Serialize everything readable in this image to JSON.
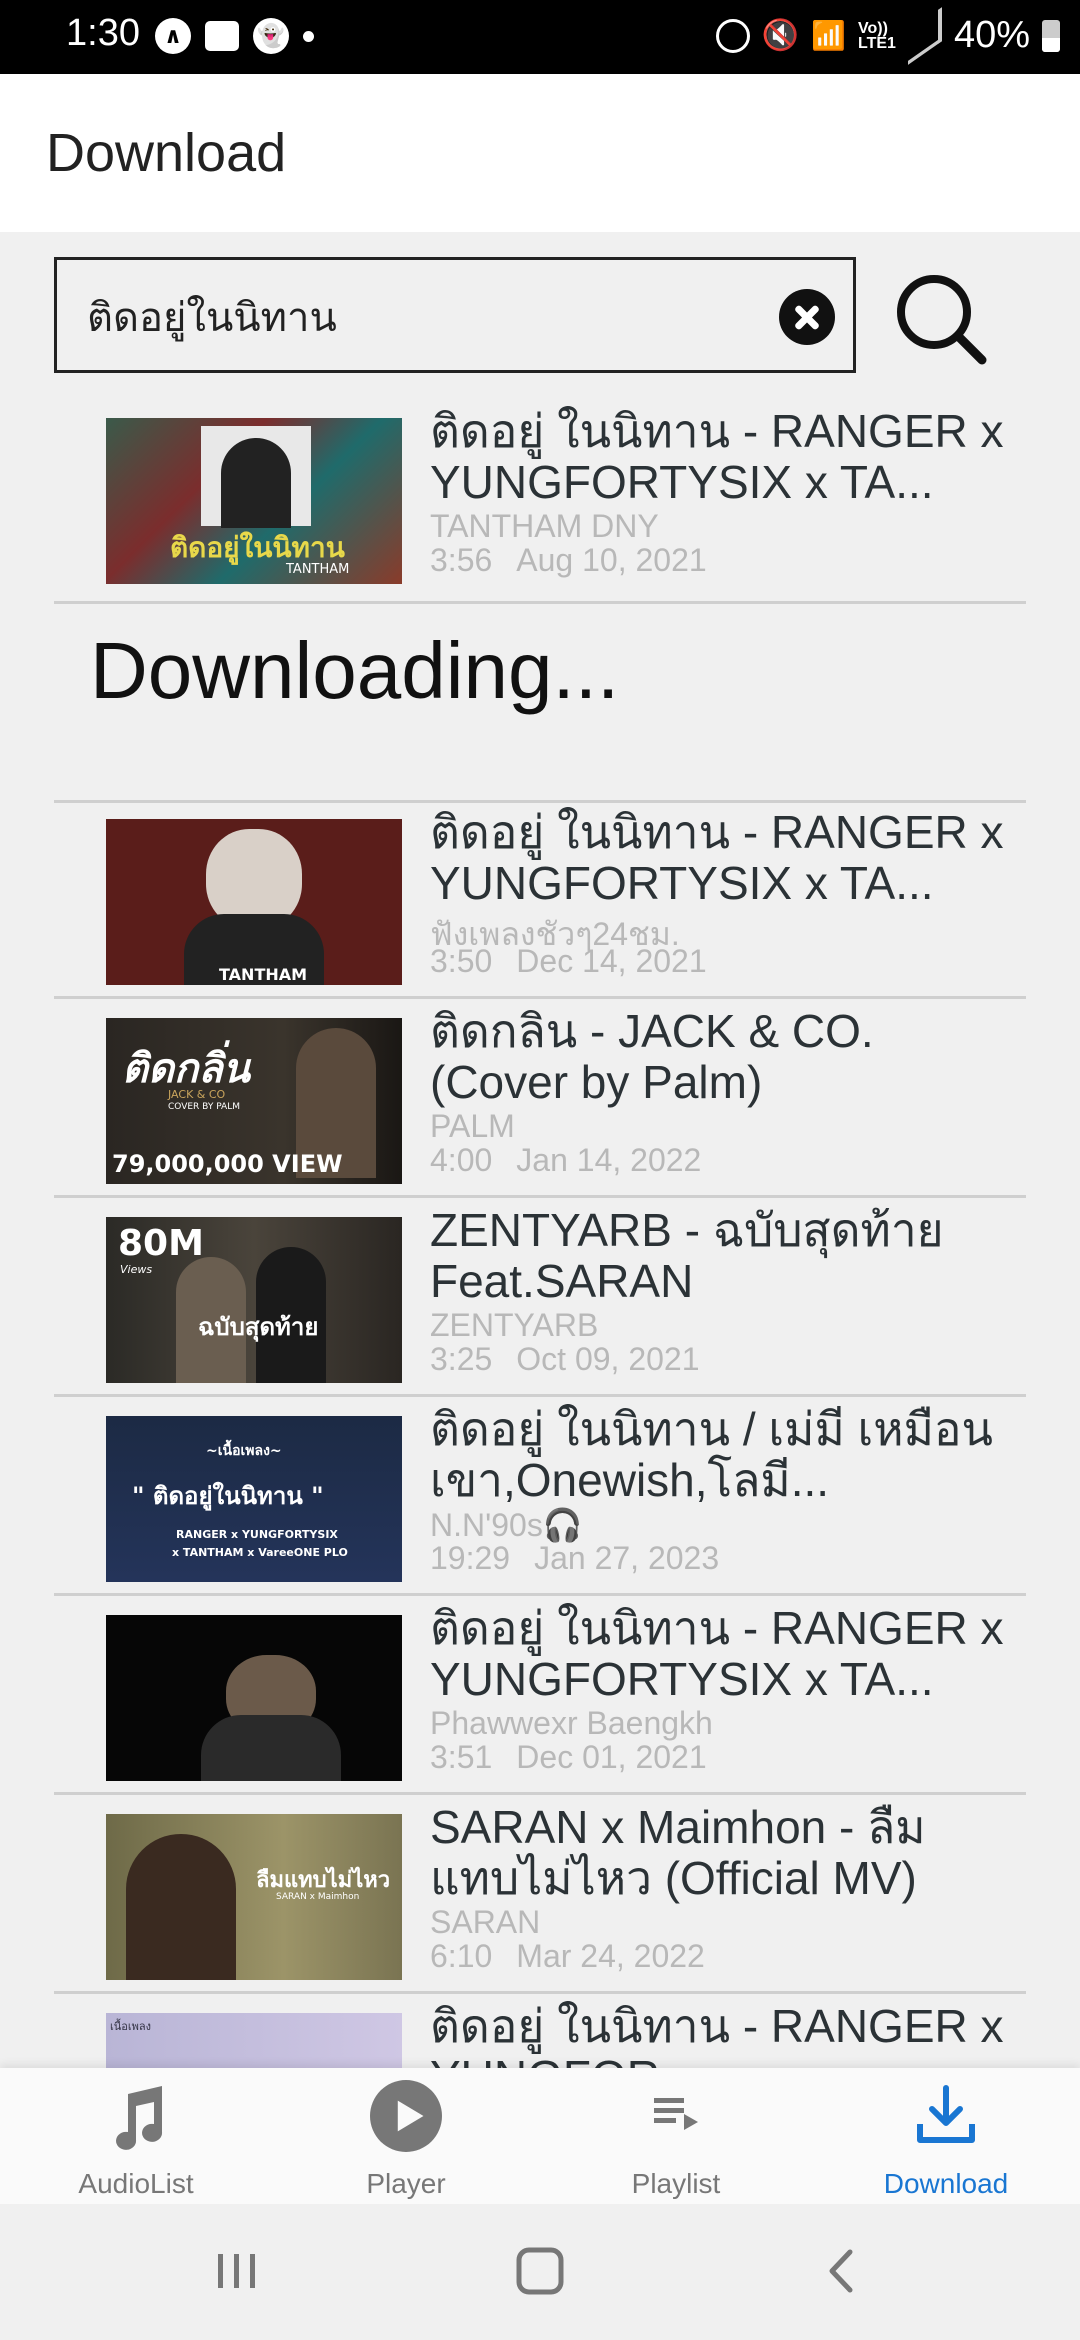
{
  "status_bar": {
    "time": "1:30",
    "net_line1": "Vo))",
    "net_line2": "LTE1",
    "battery": "40%"
  },
  "header": {
    "title": "Download"
  },
  "search": {
    "value": "ติดอยู่ในนิทาน"
  },
  "downloading_text": "Downloading...",
  "items": [
    {
      "title": "ติดอยู่ ในนิทาน - RANGER x YUNGFORTYSIX x TA...",
      "channel": "TANTHAM DNY",
      "duration": "3:56",
      "date": "Aug 10, 2021",
      "thumb_text": "ติดอยู่ในนิทาน",
      "thumb_sub": "TANTHAM"
    },
    {
      "title": "ติดอยู่ ในนิทาน - RANGER x YUNGFORTYSIX x TA...",
      "channel": "ฟังเพลงชัวๆ24ชม.",
      "duration": "3:50",
      "date": "Dec 14, 2021",
      "thumb_text": "TANTHAM"
    },
    {
      "title": "ติดกลิ่น - JACK & CO. (Cover by Palm)",
      "channel": "PALM",
      "duration": "4:00",
      "date": "Jan 14, 2022",
      "thumb_text": "ติดกลิ่น",
      "thumb_sub": "JACK & CO",
      "thumb_sub2": "COVER BY PALM",
      "thumb_views": "79,000,000 VIEW"
    },
    {
      "title": "ZENTYARB - ฉบับสุดท้าย Feat.SARAN",
      "channel": "ZENTYARB",
      "duration": "3:25",
      "date": "Oct 09, 2021",
      "thumb_text": "80M",
      "thumb_sub": "Views",
      "thumb_sub2": "ฉบับสุดท้าย"
    },
    {
      "title": "ติดอยู่ ในนิทาน / เม่มี เหมือนเขา,Onewish,โลมี...",
      "channel": "N.N'90s🎧",
      "duration": "19:29",
      "date": "Jan 27, 2023",
      "thumb_text": "~เนื้อเพลง~",
      "thumb_sub": "\" ติดอยู่ในนิทาน \"",
      "thumb_sub2": "RANGER x YUNGFORTYSIX",
      "thumb_sub3": "x TANTHAM x VareeONE PLO"
    },
    {
      "title": "ติดอยู่ ในนิทาน - RANGER x YUNGFORTYSIX x TA...",
      "channel": "Phawwexr Baengkh",
      "duration": "3:51",
      "date": "Dec 01, 2021"
    },
    {
      "title": "SARAN x Maimhon - ลืมแทบไม่ไหว (Official MV)",
      "channel": "SARAN",
      "duration": "6:10",
      "date": "Mar 24, 2022",
      "thumb_text": "ลืมแทบไม่ไหว",
      "thumb_sub": "SARAN x Maimhon"
    },
    {
      "title": "ติดอยู่ ในนิทาน - RANGER x YUNGFOR...",
      "channel": "",
      "duration": "",
      "date": "",
      "thumb_text": "เนื้อเพลง"
    }
  ],
  "nav": [
    {
      "label": "AudioList",
      "icon": "music-note-icon"
    },
    {
      "label": "Player",
      "icon": "play-circle-icon"
    },
    {
      "label": "Playlist",
      "icon": "playlist-icon"
    },
    {
      "label": "Download",
      "icon": "download-icon",
      "active": true
    }
  ],
  "colors": {
    "accent": "#1976d2",
    "background": "#f0f0f0"
  }
}
